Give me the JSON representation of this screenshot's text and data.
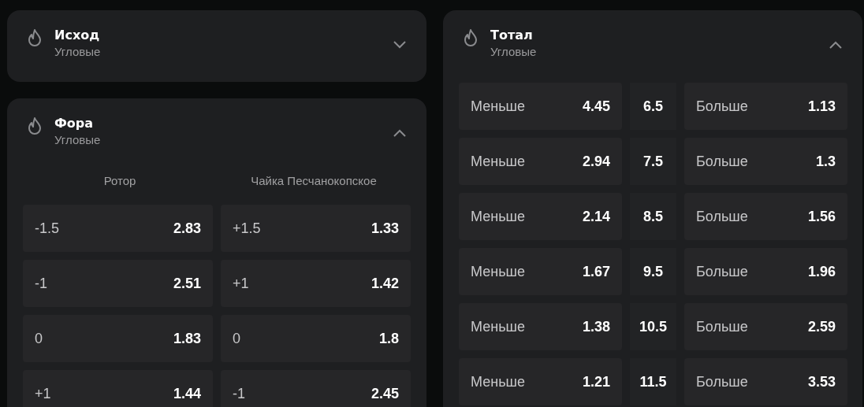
{
  "columns": [
    [
      {
        "title": "Исход",
        "subtitle": "Угловые",
        "expanded": false
      },
      {
        "kind": "handicap",
        "title": "Фора",
        "subtitle": "Угловые",
        "expanded": true,
        "teams": [
          "Ротор",
          "Чайка Песчанокопское"
        ],
        "rows": [
          [
            {
              "line": "-1.5",
              "odds": "2.83"
            },
            {
              "line": "+1.5",
              "odds": "1.33"
            }
          ],
          [
            {
              "line": "-1",
              "odds": "2.51"
            },
            {
              "line": "+1",
              "odds": "1.42"
            }
          ],
          [
            {
              "line": "0",
              "odds": "1.83"
            },
            {
              "line": "0",
              "odds": "1.8"
            }
          ],
          [
            {
              "line": "+1",
              "odds": "1.44"
            },
            {
              "line": "-1",
              "odds": "2.45"
            }
          ]
        ]
      }
    ],
    [
      {
        "kind": "total",
        "title": "Тотал",
        "subtitle": "Угловые",
        "expanded": true,
        "rows": [
          {
            "under_label": "Меньше",
            "under": "4.45",
            "line": "6.5",
            "over_label": "Больше",
            "over": "1.13"
          },
          {
            "under_label": "Меньше",
            "under": "2.94",
            "line": "7.5",
            "over_label": "Больше",
            "over": "1.3"
          },
          {
            "under_label": "Меньше",
            "under": "2.14",
            "line": "8.5",
            "over_label": "Больше",
            "over": "1.56"
          },
          {
            "under_label": "Меньше",
            "under": "1.67",
            "line": "9.5",
            "over_label": "Больше",
            "over": "1.96"
          },
          {
            "under_label": "Меньше",
            "under": "1.38",
            "line": "10.5",
            "over_label": "Больше",
            "over": "2.59"
          },
          {
            "under_label": "Меньше",
            "under": "1.21",
            "line": "11.5",
            "over_label": "Больше",
            "over": "3.53"
          }
        ]
      }
    ]
  ]
}
